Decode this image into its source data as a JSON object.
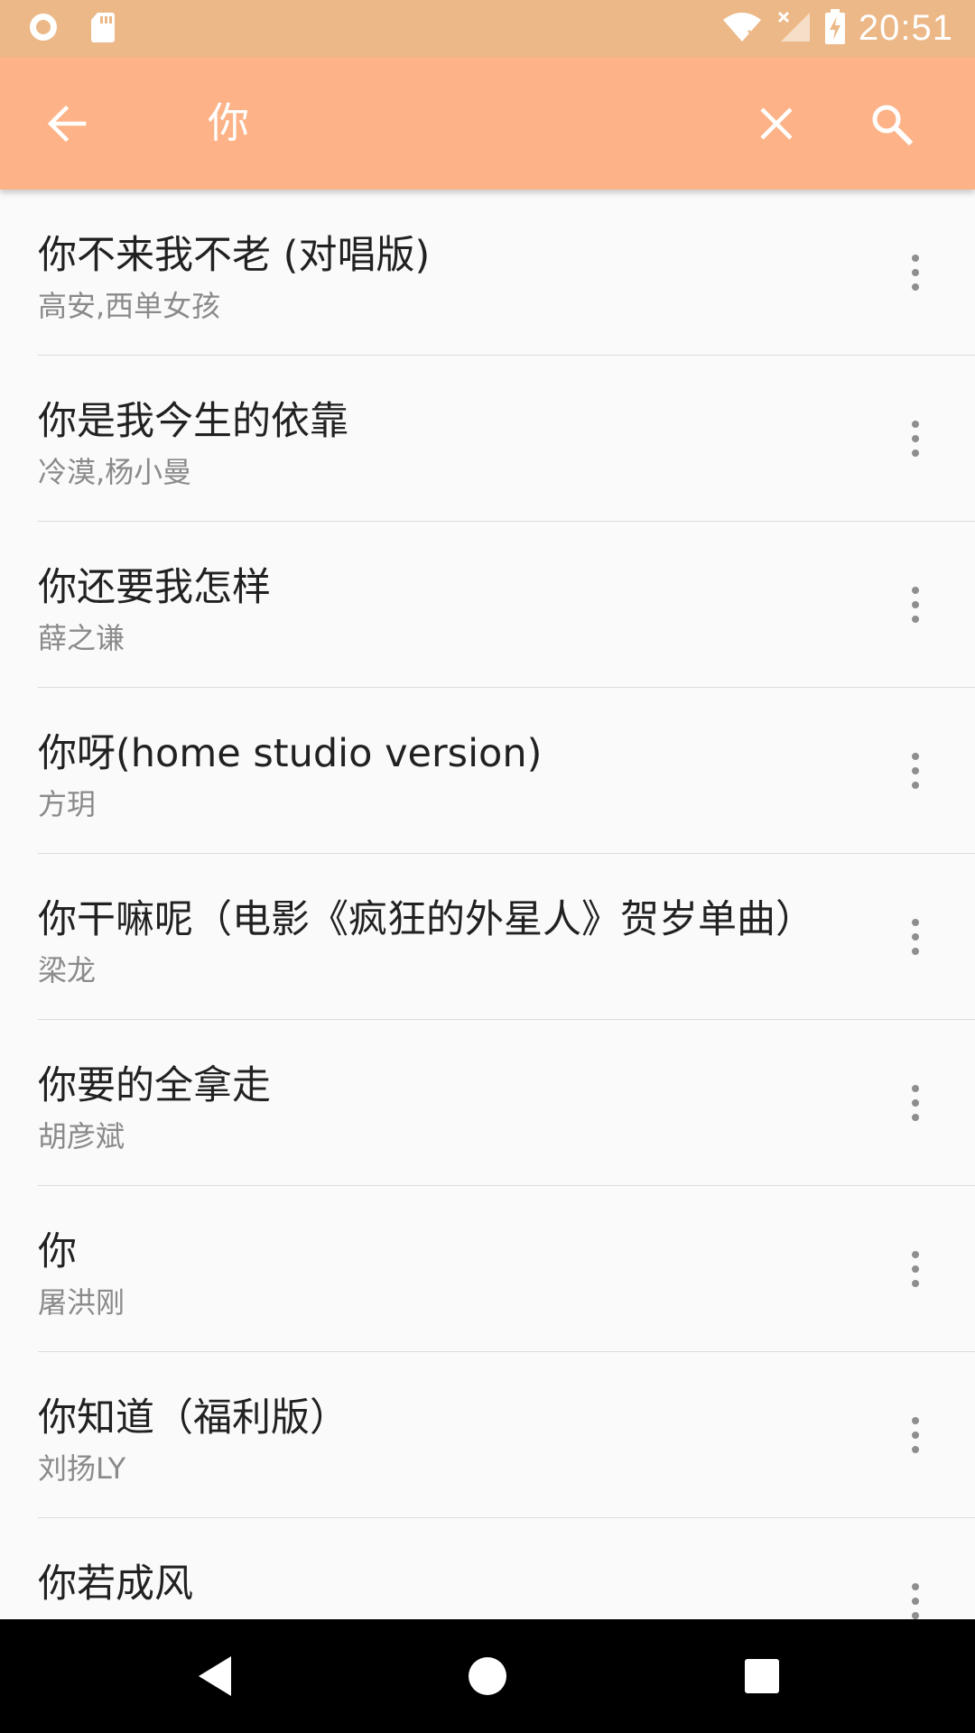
{
  "status_bar": {
    "time": "20:51",
    "icons": [
      "record-icon",
      "sd-card-icon",
      "wifi-off-icon",
      "signal-off-icon",
      "battery-charging-icon"
    ]
  },
  "app_bar": {
    "query": "你",
    "back_icon": "arrow-back-icon",
    "clear_icon": "close-icon",
    "search_icon": "search-icon",
    "background": "#fdb387"
  },
  "results": [
    {
      "title": "你不来我不老 (对唱版)",
      "artist": "高安,西单女孩"
    },
    {
      "title": "你是我今生的依靠",
      "artist": "冷漠,杨小曼"
    },
    {
      "title": "你还要我怎样",
      "artist": "薛之谦"
    },
    {
      "title": "你呀(home studio version)",
      "artist": "方玥"
    },
    {
      "title": "你干嘛呢（电影《疯狂的外星人》贺岁单曲）",
      "artist": "梁龙"
    },
    {
      "title": "你要的全拿走",
      "artist": "胡彦斌"
    },
    {
      "title": "你",
      "artist": "屠洪刚"
    },
    {
      "title": "你知道（福利版）",
      "artist": "刘扬LY"
    },
    {
      "title": "你若成风",
      "artist": ""
    }
  ],
  "nav_bar": {
    "icons": [
      "back-triangle-icon",
      "home-circle-icon",
      "recents-square-icon"
    ]
  }
}
